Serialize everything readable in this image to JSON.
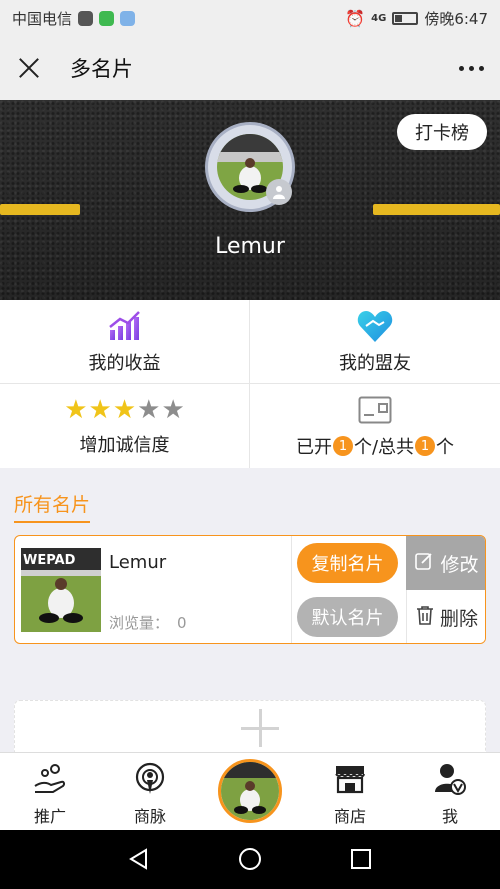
{
  "status_bar": {
    "carrier": "中国电信",
    "network_label": "4G",
    "time": "傍晚6:47",
    "battery": "low"
  },
  "nav": {
    "title": "多名片",
    "close_icon": "close-icon",
    "more_icon": "more-dots-icon"
  },
  "hero": {
    "checkin_label": "打卡榜",
    "name": "Lemur",
    "avatar_icon": "user-avatar",
    "road_line_color": "#e6b820"
  },
  "grid": {
    "earnings_label": "我的收益",
    "allies_label": "我的盟友",
    "credit_label": "增加诚信度",
    "credit_stars": {
      "filled": 3,
      "total": 5
    },
    "count_prefix": "已开",
    "opened_count": "1",
    "count_mid": "个/总共",
    "total_count": "1",
    "count_suffix": "个"
  },
  "section": {
    "title": "所有名片"
  },
  "card": {
    "name": "Lemur",
    "views_label": "浏览量：",
    "views_value": "0",
    "copy_label": "复制名片",
    "default_label": "默认名片",
    "edit_label": "修改",
    "delete_label": "删除"
  },
  "tabs": [
    {
      "label": "推广",
      "icon": "promote-icon"
    },
    {
      "label": "商脉",
      "icon": "network-icon"
    },
    {
      "label": "",
      "icon": "center-avatar"
    },
    {
      "label": "商店",
      "icon": "shop-icon"
    },
    {
      "label": "我",
      "icon": "me-icon"
    }
  ],
  "colors": {
    "accent": "#f7941d",
    "gray_button": "#b3b3b3",
    "edit_bg": "#a7a7a7"
  }
}
